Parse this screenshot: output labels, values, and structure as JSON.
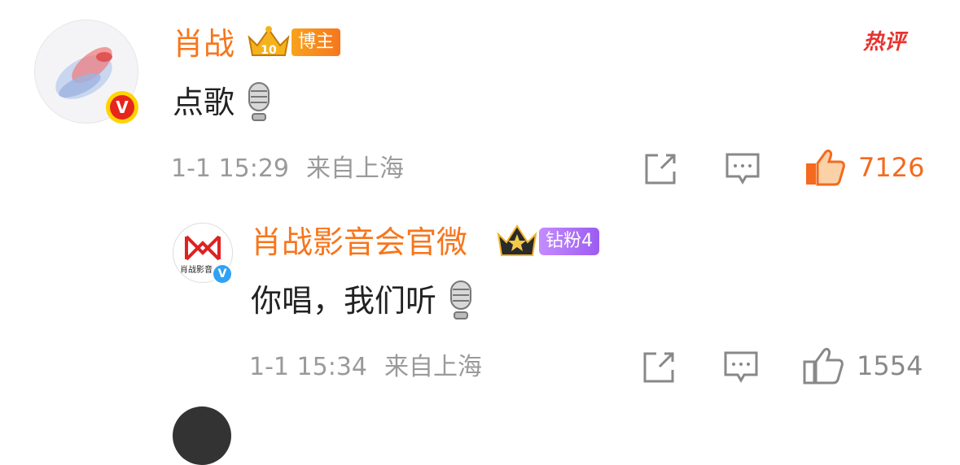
{
  "colors": {
    "accent_orange": "#f7751b",
    "like_orange": "#f46a1e",
    "hot_red": "#e8332f",
    "meta_gray": "#9a9a9a"
  },
  "hot_label": "热评",
  "comment": {
    "username": "肖战",
    "crown_level": "10",
    "badge": "博主",
    "text": "点歌",
    "time": "1-1 15:29",
    "location": "来自上海",
    "likes": "7126",
    "liked": true,
    "verified_badge": "V",
    "icons": [
      "share-icon",
      "comment-icon",
      "like-icon",
      "microphone-icon"
    ]
  },
  "reply": {
    "username": "肖战影音会官微",
    "avatar_text": "肖战影音",
    "badge": "钻粉4",
    "text": "你唱，我们听",
    "time": "1-1 15:34",
    "location": "来自上海",
    "likes": "1554",
    "liked": false,
    "verified_badge": "V"
  }
}
